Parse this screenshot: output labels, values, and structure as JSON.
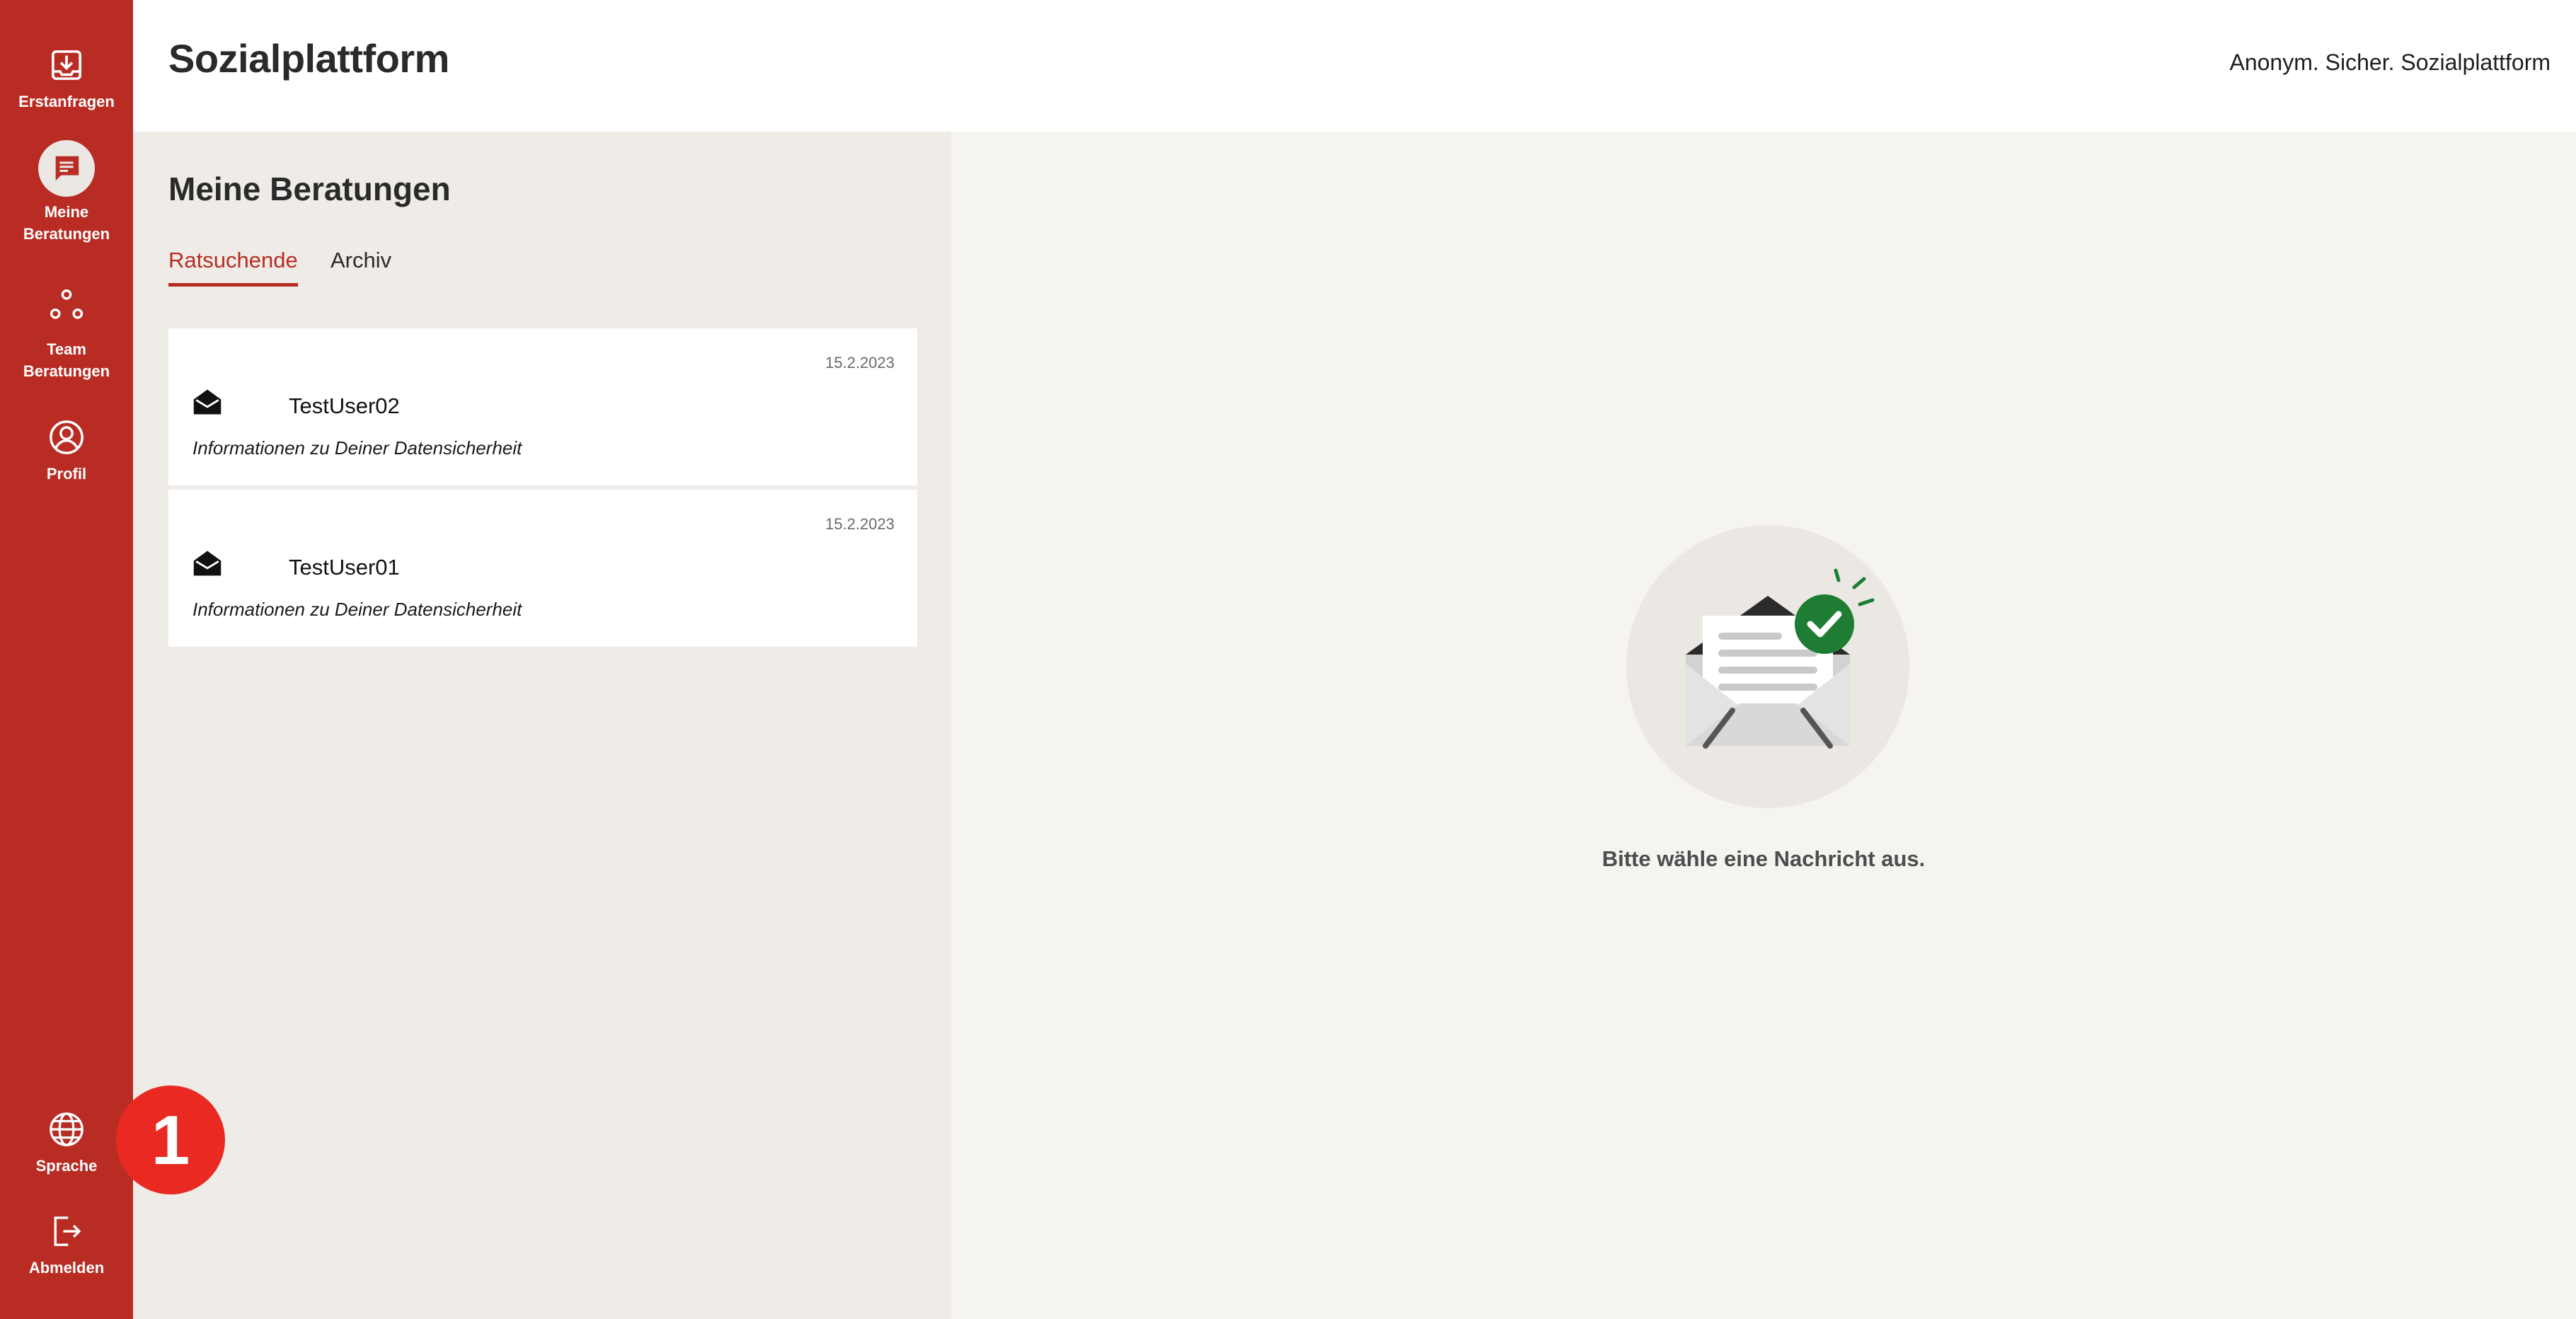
{
  "app": {
    "title": "Sozialplattform",
    "tagline": "Anonym. Sicher. Sozialplattform"
  },
  "sidebar": {
    "items": [
      {
        "label": "Erstanfragen",
        "icon": "inbox-download-icon"
      },
      {
        "label": "Meine\nBeratungen",
        "icon": "chat-message-icon",
        "active": true
      },
      {
        "label": "Team\nBeratungen",
        "icon": "team-nodes-icon"
      },
      {
        "label": "Profil",
        "icon": "user-circle-icon"
      }
    ],
    "bottom_items": [
      {
        "label": "Sprache",
        "icon": "globe-icon"
      },
      {
        "label": "Abmelden",
        "icon": "logout-icon"
      }
    ]
  },
  "list": {
    "title": "Meine Beratungen",
    "tabs": [
      {
        "label": "Ratsuchende",
        "active": true
      },
      {
        "label": "Archiv",
        "active": false
      }
    ],
    "conversations": [
      {
        "date": "15.2.2023",
        "user": "TestUser02",
        "subject": "Informationen zu Deiner Datensicherheit",
        "icon": "envelope-open-icon"
      },
      {
        "date": "15.2.2023",
        "user": "TestUser01",
        "subject": "Informationen zu Deiner Datensicherheit",
        "icon": "envelope-open-icon"
      }
    ]
  },
  "detail": {
    "empty_message": "Bitte wähle eine Nachricht aus.",
    "illustration": "envelope-check-illustration"
  },
  "annotation": {
    "badge": "1"
  },
  "colors": {
    "brand": "#b92c24",
    "panel": "#efece7",
    "background": "#f6f4f0",
    "success": "#1e7d32",
    "badge": "#ea2a22"
  }
}
